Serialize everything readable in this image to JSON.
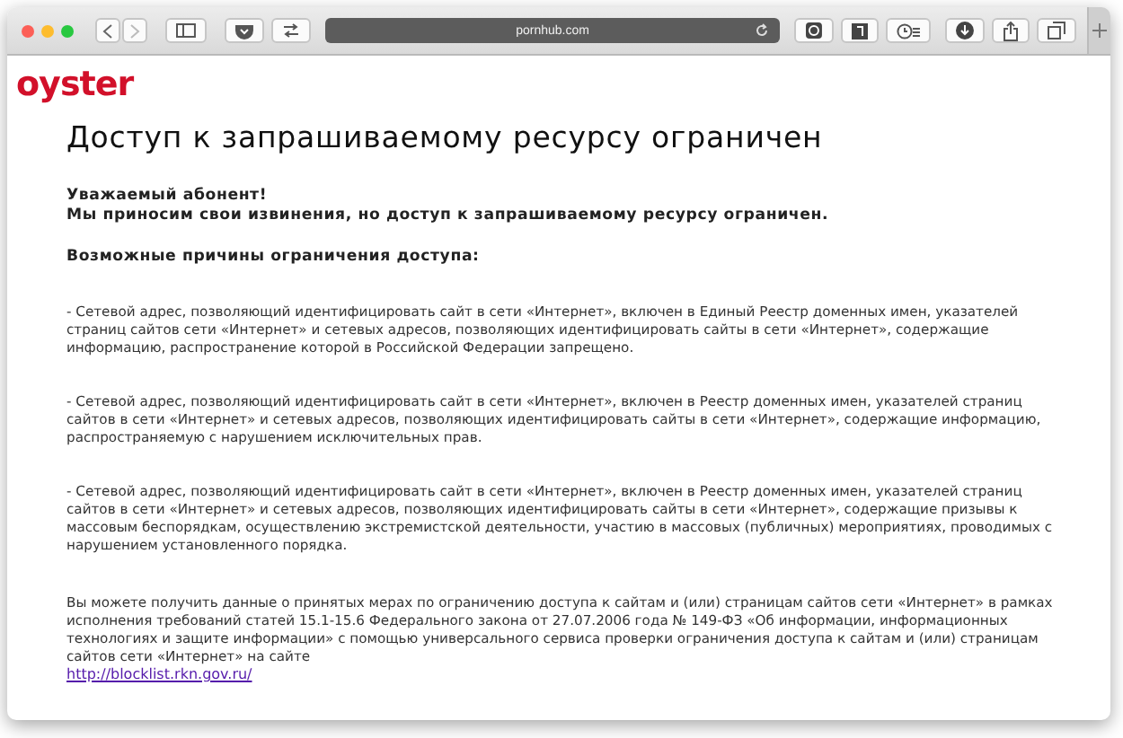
{
  "browser": {
    "address": "pornhub.com"
  },
  "page": {
    "logo": "oyster",
    "title": "Доступ к запрашиваемому ресурсу ограничен",
    "greeting": "Уважаемый абонент!",
    "apology": "Мы приносим свои извинения, но доступ к запрашиваемому ресурсу ограничен.",
    "reasons_heading": "Возможные причины ограничения доступа:",
    "reasons": [
      "- Сетевой адрес, позволяющий идентифицировать сайт в сети «Интернет», включен в Единый Реестр доменных имен, указателей страниц сайтов сети «Интернет» и сетевых адресов, позволяющих идентифицировать сайты в сети «Интернет», содержащие информацию, распространение которой в Российской Федерации запрещено.",
      "- Сетевой адрес, позволяющий идентифицировать сайт в сети «Интернет», включен в Реестр доменных имен, указателей страниц сайтов в сети «Интернет» и сетевых адресов, позволяющих идентифицировать сайты в сети «Интернет», содержащие информацию, распространяемую с нарушением исключительных прав.",
      "- Сетевой адрес, позволяющий идентифицировать сайт в сети «Интернет», включен в Реестр доменных имен, указателей страниц сайтов в сети «Интернет» и сетевых адресов, позволяющих идентифицировать сайты в сети «Интернет», содержащие призывы к массовым беспорядкам, осуществлению экстремистской деятельности, участию в массовых (публичных) мероприятиях, проводимых с нарушением установленного порядка."
    ],
    "notice": "Вы можете получить данные о принятых мерах по ограничению доступа к сайтам и (или) страницам сайтов сети «Интернет» в рамках исполнения требований статей 15.1-15.6 Федерального закона от 27.07.2006 года № 149-ФЗ «Об информации, информационных технологиях и защите информации» с помощью универсального сервиса проверки ограничения доступа к сайтам и (или) страницам сайтов сети «Интернет» на сайте",
    "link": "http://blocklist.rkn.gov.ru/"
  }
}
